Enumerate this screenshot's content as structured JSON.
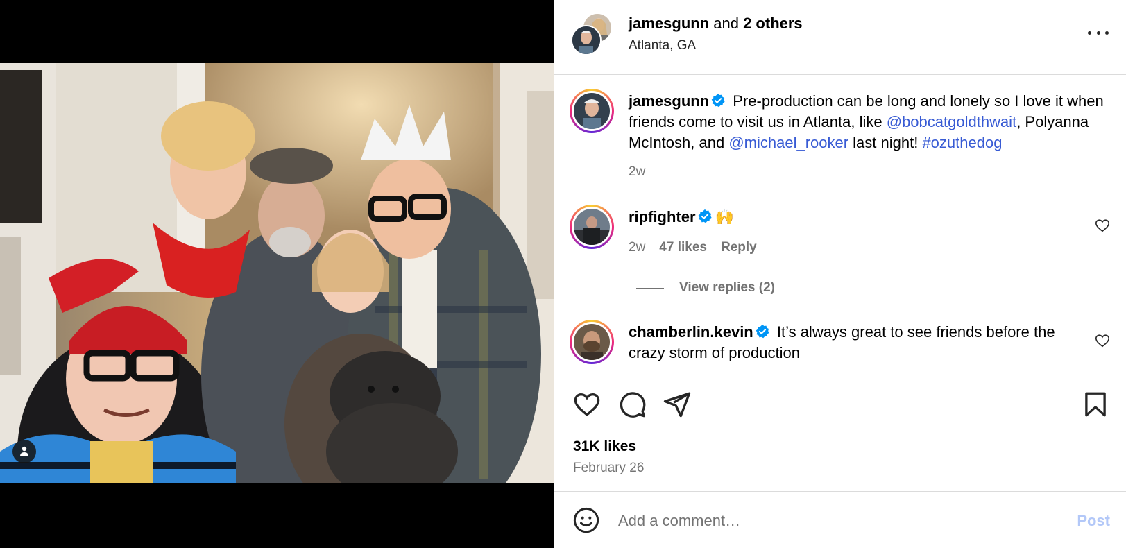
{
  "header": {
    "username": "jamesgunn",
    "and_text": " and ",
    "others": "2 others",
    "location": "Atlanta, GA"
  },
  "caption": {
    "username": "jamesgunn",
    "text_1": " Pre-production can be long and lonely so I love it when friends come to visit us in Atlanta, like ",
    "mention_1": "@bobcatgoldthwait",
    "text_2": ", Polyanna McIntosh, and ",
    "mention_2": "@michael_rooker",
    "text_3": " last night! ",
    "hashtag": "#ozuthedog",
    "age": "2w"
  },
  "comments": [
    {
      "username": "ripfighter",
      "text": "🙌",
      "age": "2w",
      "likes": "47 likes",
      "reply_label": "Reply",
      "view_replies": "View replies (2)"
    },
    {
      "username": "chamberlin.kevin",
      "text": " It’s always great to see friends before the crazy storm of production"
    }
  ],
  "post": {
    "likes": "31K likes",
    "date": "February 26"
  },
  "composer": {
    "placeholder": "Add a comment…",
    "post_label": "Post"
  },
  "icons": {
    "verified_color": "#0095f6",
    "link_color": "#385bd4",
    "post_button_color": "#b3c8f8"
  }
}
